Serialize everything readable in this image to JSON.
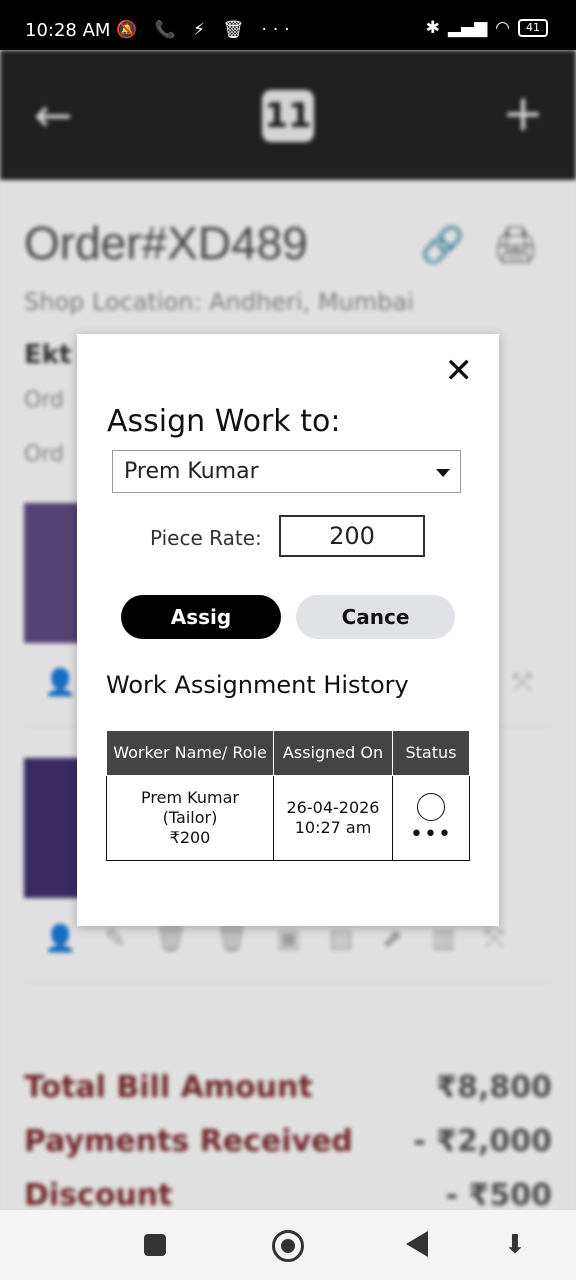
{
  "status_bar": {
    "time": "10:28 AM",
    "left_icons": "🔕 📞 ⚡ 🗑 ···",
    "battery": "41"
  },
  "header": {
    "logo": "11"
  },
  "order": {
    "title": "Order#XD489",
    "shop_location": "Shop Location: Andheri, Mumbai",
    "customer_fragment": "Ekt",
    "order_line1_fragment": "Ord",
    "order_line2_fragment": "Ord"
  },
  "totals": [
    {
      "label": "Total Bill Amount",
      "amount": "₹8,800"
    },
    {
      "label": "Payments Received",
      "amount": "- ₹2,000"
    },
    {
      "label": "Discount",
      "amount": "- ₹500"
    }
  ],
  "modal": {
    "title": "Assign Work to:",
    "selected_worker": "Prem Kumar",
    "piece_rate_label": "Piece Rate:",
    "piece_rate_value": "200",
    "assign_label": "Assig",
    "cancel_label": "Cance",
    "history_title": "Work Assignment History",
    "history_columns": [
      "Worker Name/ Role",
      "Assigned On",
      "Status"
    ],
    "history_rows": [
      {
        "name": "Prem Kumar",
        "role": "(Tailor)",
        "rate": "₹200",
        "date": "26-04-2026",
        "time": "10:27 am",
        "more": "•••"
      }
    ]
  }
}
